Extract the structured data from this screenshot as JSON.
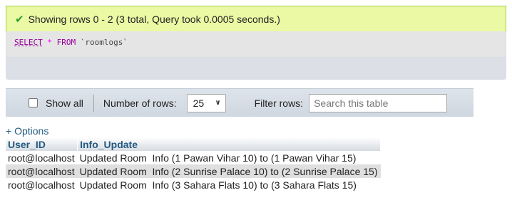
{
  "success": {
    "icon": "check-icon",
    "message": "Showing rows 0 - 2 (3 total, Query took 0.0005 seconds.)"
  },
  "sql": {
    "select": "SELECT",
    "star": "*",
    "from": "FROM",
    "table": "`roomlogs`"
  },
  "nav": {
    "show_all_label": "Show all",
    "number_of_rows_label": "Number of rows:",
    "rows_value": "25",
    "filter_label": "Filter rows:",
    "search_placeholder": "Search this table"
  },
  "options_label": "+ Options",
  "table": {
    "headers": [
      "User_ID",
      "Info_Update"
    ],
    "rows": [
      [
        "root@localhost",
        "Updated Room  Info (1 Pawan Vihar 10) to (1 Pawan Vihar 15)"
      ],
      [
        "root@localhost",
        "Updated Room  Info (2 Sunrise Palace 10) to (2 Sunrise Palace 15)"
      ],
      [
        "root@localhost",
        "Updated Room  Info (3 Sahara Flats 10) to (3 Sahara Flats 15)"
      ]
    ]
  },
  "colors": {
    "success_bg": "#ebf8a4",
    "success_border": "#a2d246",
    "link": "#235a81",
    "keyword": "#990099"
  }
}
